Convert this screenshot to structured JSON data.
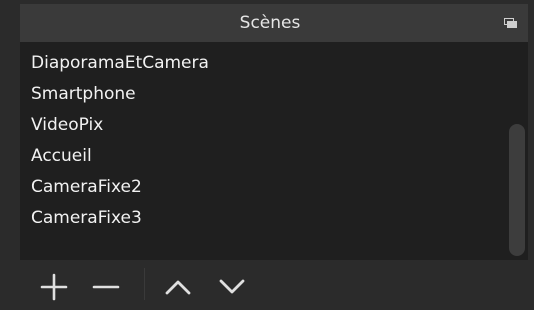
{
  "dock": {
    "title": "Scènes",
    "float_icon": "float-window-icon"
  },
  "scenes": [
    {
      "label": "DiaporamaEtCamera"
    },
    {
      "label": "Smartphone"
    },
    {
      "label": "VideoPix"
    },
    {
      "label": "Accueil"
    },
    {
      "label": "CameraFixe2"
    },
    {
      "label": "CameraFixe3"
    }
  ],
  "toolbar": {
    "buttons": [
      {
        "icon": "plus-icon"
      },
      {
        "icon": "minus-icon"
      },
      {
        "icon": "chevron-up-icon"
      },
      {
        "icon": "chevron-down-icon"
      }
    ]
  },
  "colors": {
    "background": "#2b2b2b",
    "title_bar": "#3a3a3a",
    "list_background": "#1f1f1f",
    "text": "#f2f2f2",
    "icon": "#e0e0e0"
  }
}
